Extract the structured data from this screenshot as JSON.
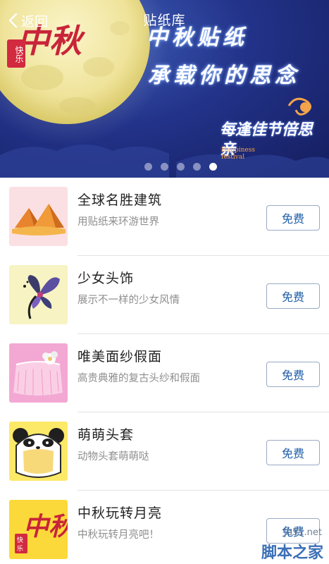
{
  "header": {
    "back_label": "返回",
    "title": "贴纸库"
  },
  "banner": {
    "logo_text_main": "中秋",
    "logo_text_small": "快乐",
    "slogan_line1": "中秋贴纸",
    "slogan_line2": "承载你的思念",
    "badge_text": "每逢佳节倍思亲",
    "badge_english": "Happiness festival",
    "dots_count": 5,
    "active_dot": 5
  },
  "items": [
    {
      "name": "全球名胜建筑",
      "desc": "用贴纸来环游世界",
      "button": "免费",
      "thumb": "pyramid-icon",
      "thumb_bg": "#fbe0e3"
    },
    {
      "name": "少女头饰",
      "desc": "展示不一样的少女风情",
      "button": "免费",
      "thumb": "butterfly-headpiece-icon",
      "thumb_bg": "#f7f3c3"
    },
    {
      "name": "唯美面纱假面",
      "desc": "高贵典雅的复古头纱和假面",
      "button": "免费",
      "thumb": "veil-icon",
      "thumb_bg": "#f2a8d2"
    },
    {
      "name": "萌萌头套",
      "desc": "动物头套萌萌哒",
      "button": "免费",
      "thumb": "panda-hood-icon",
      "thumb_bg": "#fde968"
    },
    {
      "name": "中秋玩转月亮",
      "desc": "中秋玩转月亮吧！",
      "button": "免费",
      "thumb": "mid-autumn-logo-icon",
      "thumb_bg": "#fcd93a"
    }
  ],
  "watermark": {
    "site": "jb51.net",
    "label": "脚本之家"
  },
  "colors": {
    "banner_dark": "#141d5e",
    "banner_mid": "#23338a",
    "moon": "#f2e8a8",
    "button_text": "#1f5ea8",
    "button_border": "#9aaac4",
    "divider": "#e2e2e2"
  }
}
